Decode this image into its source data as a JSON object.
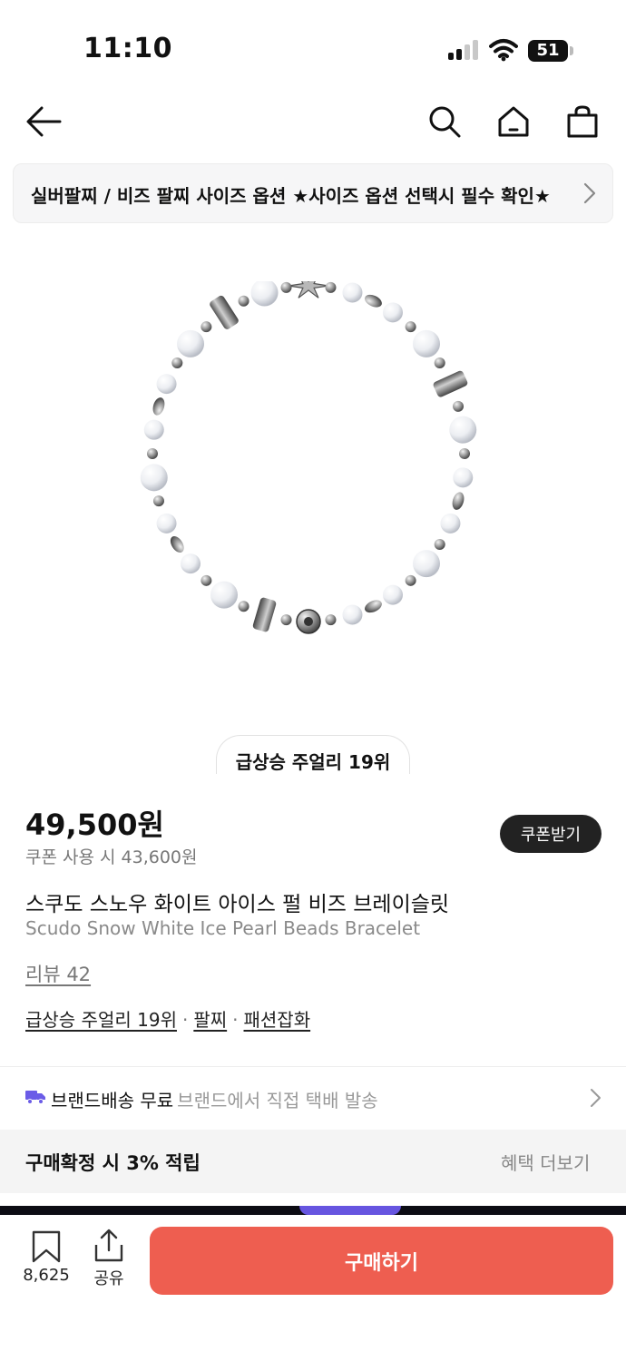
{
  "status_bar": {
    "time": "11:10",
    "battery": "51",
    "icons": [
      "cellular-signal-icon",
      "wifi-icon",
      "battery-icon"
    ]
  },
  "nav": {
    "icons": [
      "back-arrow-icon",
      "search-icon",
      "home-icon",
      "shopping-bag-icon"
    ]
  },
  "banner": {
    "text": "실버팔찌 / 비즈 팔찌 사이즈 옵션 ★사이즈 옵션 선택시 필수 확인★",
    "icon": "chevron-right-icon"
  },
  "product": {
    "image_icon": "pearl-beads-bracelet-image",
    "rank_chip": "급상승 주얼리 19위",
    "price": "49,500원",
    "coupon_price": "쿠폰 사용 시 43,600원",
    "coupon_button": "쿠폰받기",
    "name_ko": "스쿠도 스노우 화이트 아이스 펄 비즈 브레이슬릿",
    "name_en": "Scudo Snow White Ice Pearl Beads Bracelet",
    "review": "리뷰 42",
    "categories": [
      "급상승 주얼리 19위",
      "팔찌",
      "패션잡화"
    ]
  },
  "shipping": {
    "icon": "delivery-truck-icon",
    "bold": "브랜드배송 무료",
    "sub": "브랜드에서 직접 택배 발송"
  },
  "benefit": {
    "label": "구매확정 시 3% 적립",
    "more": "혜택 더보기"
  },
  "bottom_bar": {
    "wish_count": "8,625",
    "share_label": "공유",
    "buy_button": "구매하기"
  },
  "colors": {
    "accent": "#ee5e50",
    "shipping_icon": "#6b5ce7",
    "dark_button": "#222222"
  }
}
